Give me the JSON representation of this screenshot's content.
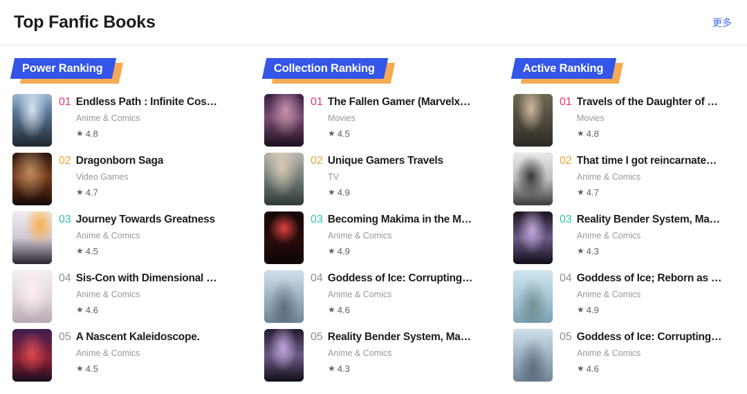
{
  "header": {
    "title": "Top Fanfic Books",
    "more_label": "更多",
    "more_color": "#3c6ef0"
  },
  "rank_colors": {
    "first": "#e8336d",
    "second": "#f0a230",
    "third": "#2fc6a4",
    "other": "#8d8d93"
  },
  "badge": {
    "fill_color": "#3355e8",
    "accent_color": "#f5ab55"
  },
  "columns": [
    {
      "tab_label": "Power Ranking",
      "items": [
        {
          "rank": "01",
          "title": "Endless Path : Infinite Cos…",
          "category": "Anime & Comics",
          "rating": "4.8",
          "star": "★"
        },
        {
          "rank": "02",
          "title": "Dragonborn Saga",
          "category": "Video Games",
          "rating": "4.7",
          "star": "★"
        },
        {
          "rank": "03",
          "title": "Journey Towards Greatness",
          "category": "Anime & Comics",
          "rating": "4.5",
          "star": "★"
        },
        {
          "rank": "04",
          "title": "Sis-Con with Dimensional …",
          "category": "Anime & Comics",
          "rating": "4.6",
          "star": "★"
        },
        {
          "rank": "05",
          "title": "A Nascent Kaleidoscope.",
          "category": "Anime & Comics",
          "rating": "4.5",
          "star": "★"
        }
      ]
    },
    {
      "tab_label": "Collection Ranking",
      "items": [
        {
          "rank": "01",
          "title": "The Fallen Gamer (Marvelx…",
          "category": "Movies",
          "rating": "4.5",
          "star": "★"
        },
        {
          "rank": "02",
          "title": "Unique Gamers Travels",
          "category": "TV",
          "rating": "4.9",
          "star": "★"
        },
        {
          "rank": "03",
          "title": "Becoming Makima in the M…",
          "category": "Anime & Comics",
          "rating": "4.9",
          "star": "★"
        },
        {
          "rank": "04",
          "title": "Goddess of Ice: Corrupting…",
          "category": "Anime & Comics",
          "rating": "4.6",
          "star": "★"
        },
        {
          "rank": "05",
          "title": "Reality Bender System, Ma…",
          "category": "Anime & Comics",
          "rating": "4.3",
          "star": "★"
        }
      ]
    },
    {
      "tab_label": "Active Ranking",
      "items": [
        {
          "rank": "01",
          "title": "Travels of the Daughter of …",
          "category": "Movies",
          "rating": "4.8",
          "star": "★"
        },
        {
          "rank": "02",
          "title": "That time I got reincarnate…",
          "category": "Anime & Comics",
          "rating": "4.7",
          "star": "★"
        },
        {
          "rank": "03",
          "title": "Reality Bender System, Ma…",
          "category": "Anime & Comics",
          "rating": "4.3",
          "star": "★"
        },
        {
          "rank": "04",
          "title": "Goddess of Ice; Reborn as …",
          "category": "Anime & Comics",
          "rating": "4.9",
          "star": "★"
        },
        {
          "rank": "05",
          "title": "Goddess of Ice: Corrupting…",
          "category": "Anime & Comics",
          "rating": "4.6",
          "star": "★"
        }
      ]
    }
  ]
}
